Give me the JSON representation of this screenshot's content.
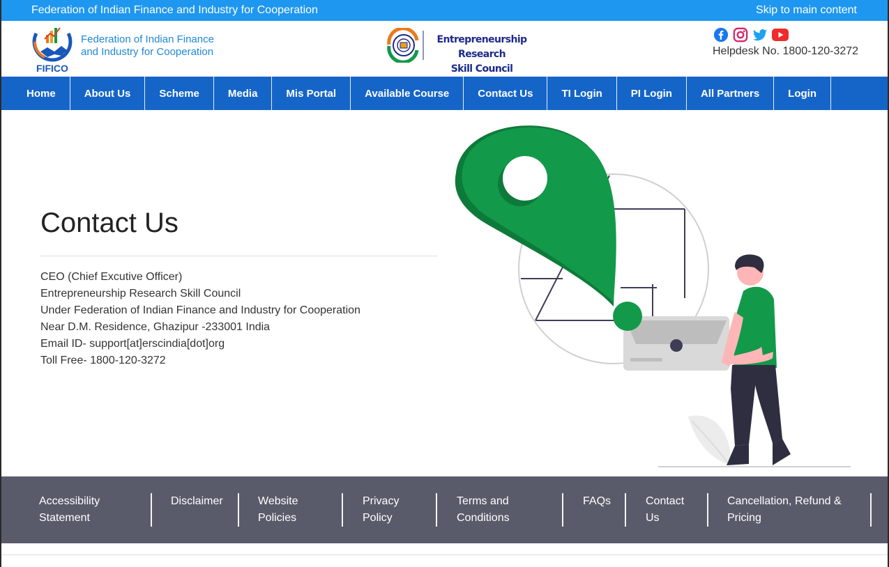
{
  "topbar": {
    "org_name": "Federation of Indian Finance and Industry for Cooperation",
    "skip_link": "Skip to main content"
  },
  "header": {
    "logo_text": "FIFICO",
    "org_name_line1": "Federation of Indian Finance",
    "org_name_line2": "and Industry for Cooperation",
    "ersc_line1": "Entrepreneurship Research",
    "ersc_line2": "Skill Council",
    "social_icons": [
      "facebook-icon",
      "instagram-icon",
      "twitter-icon",
      "youtube-icon"
    ],
    "helpdesk": "Helpdesk No. 1800-120-3272"
  },
  "nav": {
    "items": [
      {
        "label": "Home"
      },
      {
        "label": "About Us"
      },
      {
        "label": "Scheme"
      },
      {
        "label": "Media"
      },
      {
        "label": "Mis Portal"
      },
      {
        "label": "Available Course"
      },
      {
        "label": "Contact Us"
      },
      {
        "label": "TI Login"
      },
      {
        "label": "PI Login"
      },
      {
        "label": "All Partners"
      },
      {
        "label": "Login"
      }
    ]
  },
  "main": {
    "title": "Contact Us",
    "address_lines": [
      "CEO (Chief Excutive Officer)",
      "Entrepreneurship Research Skill Council",
      "Under Federation of Indian Finance and Industry for Cooperation",
      "Near D.M. Residence, Ghazipur -233001 India",
      "Email ID- support[at]erscindia[dot]org",
      "Toll Free- 1800-120-3272"
    ]
  },
  "footer": {
    "links": [
      {
        "line1": "Accessibility",
        "line2": "Statement"
      },
      {
        "line1": "Disclaimer",
        "line2": ""
      },
      {
        "line1": "Website",
        "line2": "Policies"
      },
      {
        "line1": "Privacy",
        "line2": "Policy"
      },
      {
        "line1": "Terms and",
        "line2": "Conditions"
      },
      {
        "line1": "FAQs",
        "line2": ""
      },
      {
        "line1": "Contact",
        "line2": "Us"
      },
      {
        "line1": "Cancellation, Refund &",
        "line2": "Pricing"
      }
    ]
  },
  "colors": {
    "topbar": "#1e97f0",
    "nav": "#1565c8",
    "footer": "#5a5b6a",
    "accent_green": "#12994a"
  }
}
